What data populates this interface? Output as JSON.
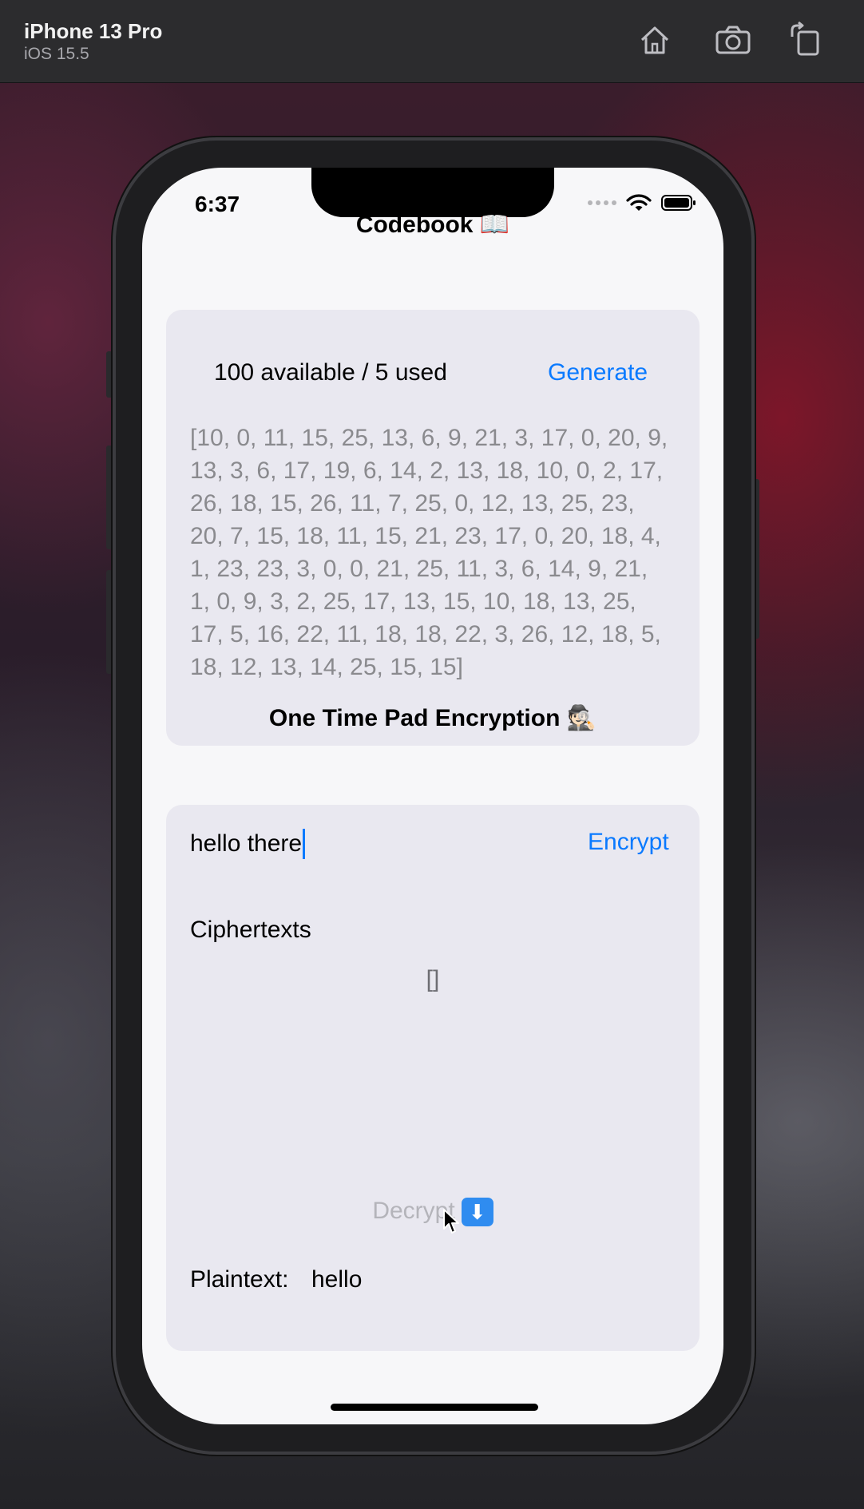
{
  "simulator": {
    "device_name": "iPhone 13 Pro",
    "os_version": "iOS 15.5",
    "home_icon": "home-icon",
    "screenshot_icon": "camera-icon",
    "rotate_icon": "rotate-icon"
  },
  "status_bar": {
    "time": "6:37"
  },
  "codebook": {
    "title": "Codebook 📖",
    "count_text": "100 available / 5 used",
    "generate_label": "Generate",
    "values": "[10, 0, 11, 15, 25, 13, 6, 9, 21, 3, 17, 0, 20, 9, 13, 3, 6, 17, 19, 6, 14, 2, 13, 18, 10, 0, 2, 17, 26, 18, 15, 26, 11, 7, 25, 0, 12, 13, 25, 23, 20, 7, 15, 18, 11, 15, 21, 23, 17, 0, 20, 18, 4, 1, 23, 23, 3, 0, 0, 21, 25, 11, 3, 6, 14, 9, 21, 1, 0, 9, 3, 2, 25, 17, 13, 15, 10, 18, 13, 25, 17, 5, 16, 22, 11, 18, 18, 22, 3, 26, 12, 18, 5, 18, 12, 13, 14, 25, 15, 15]"
  },
  "otp": {
    "title": "One Time Pad Encryption 🕵🏻",
    "input_value": "hello there",
    "encrypt_label": "Encrypt",
    "ciphertexts_label": "Ciphertexts",
    "ciphertexts_value": "[]",
    "decrypt_label": "Decrypt",
    "decrypt_emoji": "⬇",
    "plaintext_label": "Plaintext:",
    "plaintext_value": "hello"
  },
  "colors": {
    "accent": "#0a7aff",
    "card_background": "#e9e8f0",
    "screen_background": "#f7f7f9"
  }
}
